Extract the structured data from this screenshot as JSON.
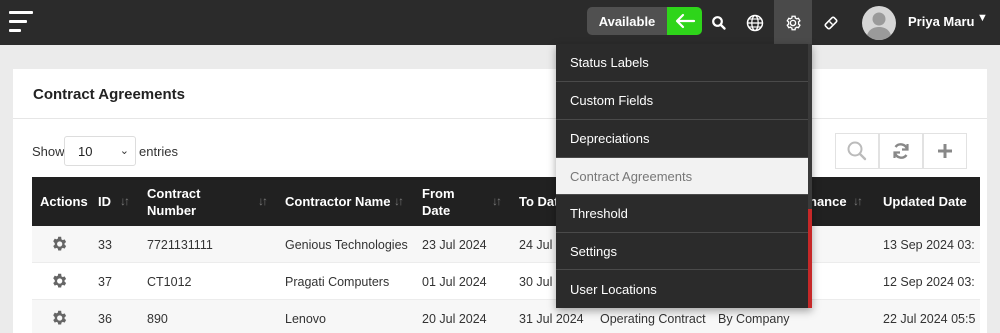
{
  "topbar": {
    "status_label": "Available",
    "user": {
      "name": "Priya Maru"
    }
  },
  "card": {
    "title": "Contract Agreements",
    "show_label": "Show",
    "entries_value": "10",
    "entries_label": "entries"
  },
  "table": {
    "columns": [
      "Actions",
      "ID",
      "Contract Number",
      "Contractor Name",
      "From Date",
      "To Date",
      "nance",
      "Updated Date"
    ],
    "rows": [
      {
        "id": "33",
        "contract_number": "7721131111",
        "contractor_name": "Genious Technologies",
        "from_date": "23 Jul 2024",
        "to_date": "24 Jul 20",
        "type": "",
        "by": "",
        "updated": "13 Sep 2024 03:"
      },
      {
        "id": "37",
        "contract_number": "CT1012",
        "contractor_name": "Pragati Computers",
        "from_date": "01 Jul 2024",
        "to_date": "30 Jul 20",
        "type": "",
        "by": "",
        "updated": "12 Sep 2024 03:"
      },
      {
        "id": "36",
        "contract_number": "890",
        "contractor_name": "Lenovo",
        "from_date": "20 Jul 2024",
        "to_date": "31 Jul 2024",
        "type": "Operating Contract",
        "by": "By Company",
        "updated": "22 Jul 2024 05:5"
      }
    ]
  },
  "settings_menu": {
    "items": [
      "Status Labels",
      "Custom Fields",
      "Depreciations",
      "Contract Agreements",
      "Threshold",
      "Settings",
      "User Locations"
    ],
    "active_index": 3
  },
  "colors": {
    "topbar": "#2b2b2b",
    "accent_green": "#2ed51a",
    "table_header": "#212121",
    "scroll_red": "#c62828"
  },
  "icons": [
    "hamburger-icon",
    "arrow-left-icon",
    "search-icon",
    "globe-icon",
    "gear-icon",
    "wand-icon",
    "avatar",
    "caret-down-icon",
    "refresh-icon",
    "plus-icon"
  ]
}
